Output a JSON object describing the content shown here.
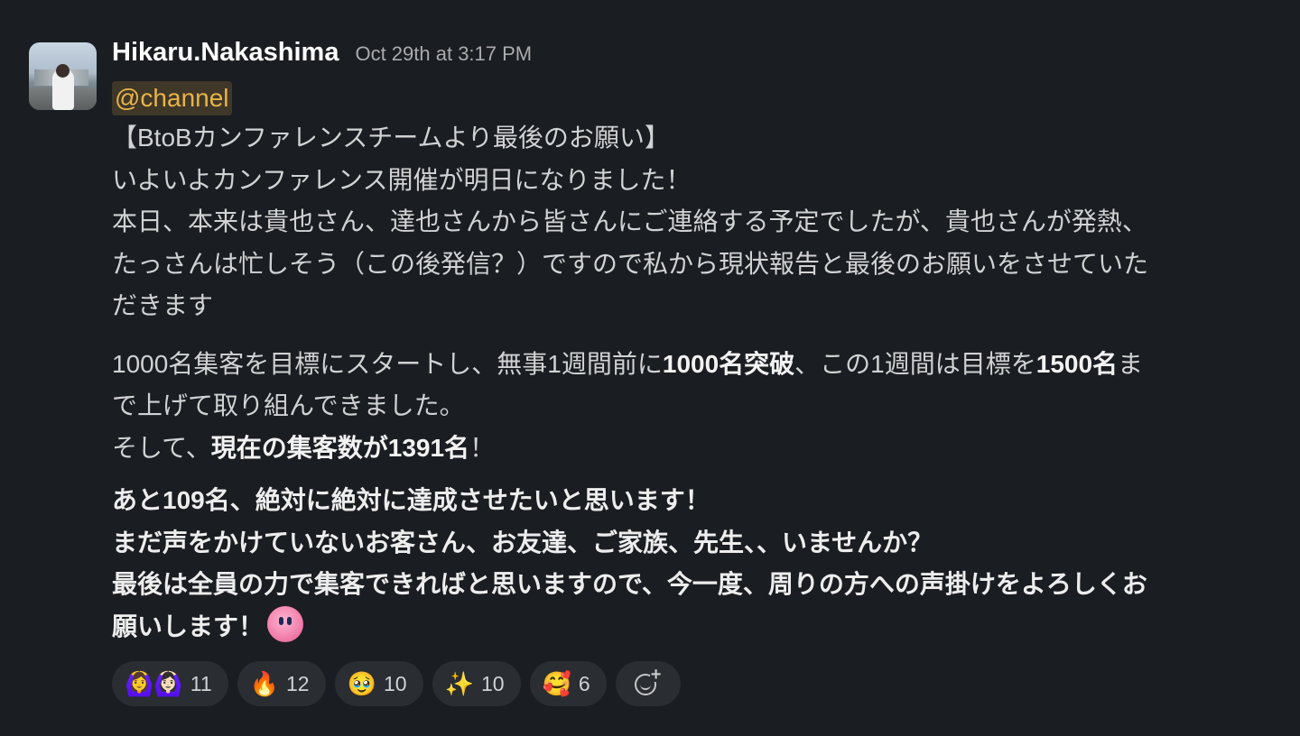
{
  "message": {
    "username": "Hikaru.Nakashima",
    "timestamp": "Oct 29th at 3:17 PM",
    "mention": "@channel",
    "lines1": [
      "【BtoBカンファレンスチームより最後のお願い】",
      "いよいよカンファレンス開催が明日になりました！",
      "本日、本来は貴也さん、達也さんから皆さんにご連絡する予定でしたが、貴也さんが発熱、",
      "たっさんは忙しそう（この後発信？）ですので私から現状報告と最後のお願いをさせていた",
      "だきます"
    ],
    "p2": {
      "a": "1000名集客を目標にスタートし、無事1週間前に",
      "b_bold": "1000名突破",
      "c": "、この1週間は目標を",
      "d_bold": "1500名",
      "e": "ま",
      "line2": "で上げて取り組んできました。",
      "line3_a": "そして、",
      "line3_bold": "現在の集客数が1391名",
      "line3_c": "！"
    },
    "lines3": [
      "あと109名、絶対に絶対に達成させたいと思います！",
      "まだ声をかけていないお客さん、お友達、ご家族、先生、、いませんか？",
      "最後は全員の力で集客できればと思いますので、今一度、周りの方への声掛けをよろしくお",
      "願いします！"
    ],
    "inline_emoji": "kirby-emoji"
  },
  "reactions": [
    {
      "emoji": "🙆‍♀️🙆🏻‍♀️",
      "count": "11"
    },
    {
      "emoji": "🔥",
      "count": "12"
    },
    {
      "emoji": "🥹",
      "count": "10"
    },
    {
      "emoji": "✨",
      "count": "10"
    },
    {
      "emoji": "🥰",
      "count": "6"
    }
  ],
  "add_reaction_icon": "add-reaction-icon"
}
